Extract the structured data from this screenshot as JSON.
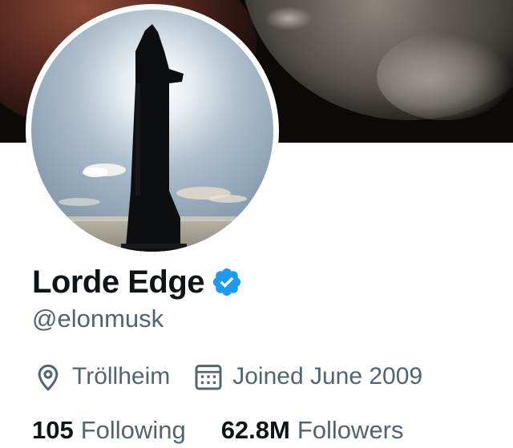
{
  "profile": {
    "display_name": "Lorde Edge",
    "verified": true,
    "handle": "@elonmusk",
    "location": "Tröllheim",
    "joined": "Joined June 2009",
    "location_icon": "location-pin-icon",
    "calendar_icon": "calendar-icon",
    "verified_icon": "verified-badge-icon"
  },
  "stats": {
    "following_count": "105",
    "following_label": "Following",
    "followers_count": "62.8M",
    "followers_label": "Followers"
  },
  "colors": {
    "text_primary": "#0f1419",
    "text_secondary": "#536471",
    "verified_blue": "#1d9bf0",
    "banner_dark": "#0b0a09"
  }
}
